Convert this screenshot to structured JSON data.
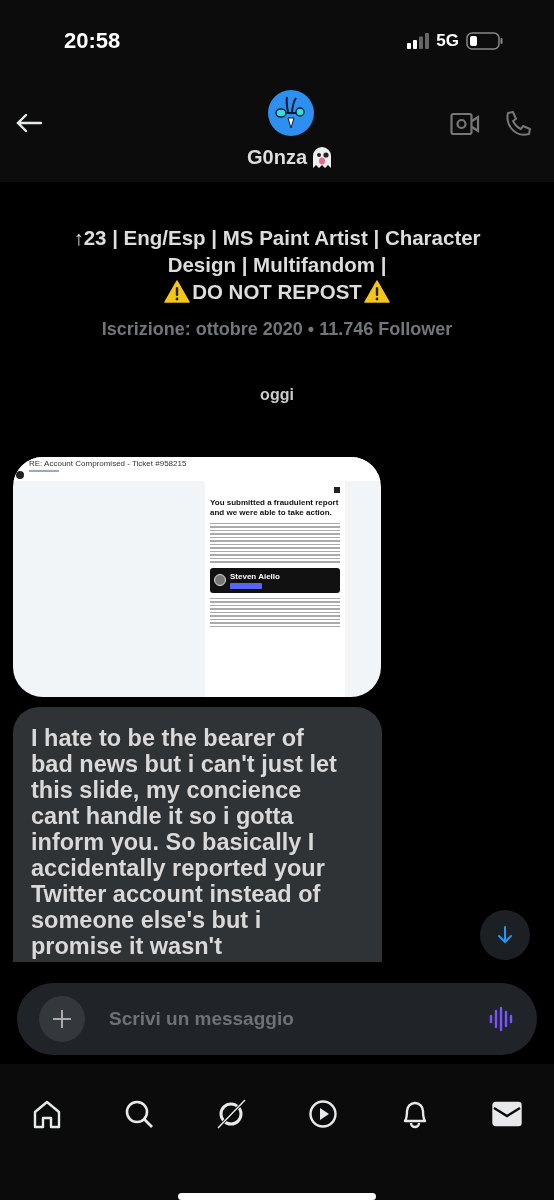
{
  "status_bar": {
    "time": "20:58",
    "network": "5G"
  },
  "header": {
    "name": "G0nza"
  },
  "profile": {
    "bio": "↑23 | Eng/Esp | MS Paint Artist | Character Design | Multifandom |",
    "warning": "DO NOT REPOST",
    "joined": "Iscrizione: ottobre 2020 • 11.746 Follower"
  },
  "date_divider": "oggi",
  "messages": [
    {
      "kind": "image",
      "screenshot": {
        "title": "RE: Account Compromised - Ticket #958215",
        "heading": "You submitted a fraudulent report and we were able to take action.",
        "contact_name": "Steven Aiello"
      }
    },
    {
      "kind": "text",
      "text": "I hate to be the bearer of bad news but i can't just let this slide, my concience cant handle it so i gotta inform you. So basically I accidentally reported your Twitter account instead of someone else's but i promise it wasn't"
    }
  ],
  "composer": {
    "placeholder": "Scrivi un messaggio"
  },
  "nav": [
    {
      "selected": false
    },
    {
      "selected": false
    },
    {
      "selected": false
    },
    {
      "selected": false
    },
    {
      "selected": false
    },
    {
      "selected": true
    }
  ]
}
